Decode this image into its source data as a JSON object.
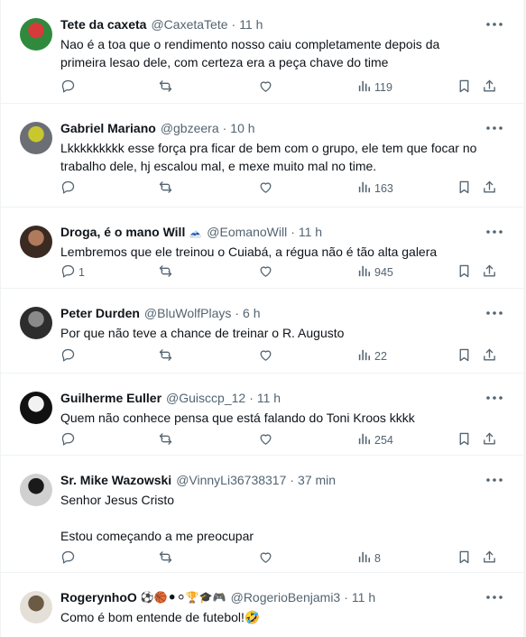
{
  "tweets": [
    {
      "name": "Tete da caxeta",
      "emojis": "",
      "handle": "@CaxetaTete",
      "time": "11 h",
      "lines": [
        "Nao é a toa que o rendimento nosso caiu completamente depois da",
        "primeira lesao dele, com certeza era a peça chave do time"
      ],
      "replies": "",
      "views": "119",
      "avatar_colors": [
        "#d73a3a",
        "#2f8a3e"
      ]
    },
    {
      "name": "Gabriel Mariano",
      "emojis": "",
      "handle": "@gbzeera",
      "time": "10 h",
      "lines": [
        "Lkkkkkkkkk esse força pra ficar de bem com o grupo, ele tem que focar no",
        "trabalho dele, hj escalou mal, e mexe muito mal no time."
      ],
      "replies": "",
      "views": "163",
      "avatar_colors": [
        "#c9c72e",
        "#6b6f75"
      ]
    },
    {
      "name": "Droga, é o mano Will",
      "emojis": "🗻",
      "handle": "@EomanoWill",
      "time": "11 h",
      "lines": [
        "Lembremos que ele treinou o Cuiabá, a régua não é tão alta galera"
      ],
      "replies": "1",
      "views": "945",
      "avatar_colors": [
        "#b07a5c",
        "#3a2a22"
      ]
    },
    {
      "name": "Peter Durden",
      "emojis": "",
      "handle": "@BluWolfPlays",
      "time": "6 h",
      "lines": [
        "Por que não teve a chance de treinar o R. Augusto"
      ],
      "replies": "",
      "views": "22",
      "avatar_colors": [
        "#8a8a8a",
        "#2d2d2d"
      ]
    },
    {
      "name": "Guilherme Euller",
      "emojis": "",
      "handle": "@Guisccp_12",
      "time": "11 h",
      "lines": [
        "Quem não conhece pensa que está falando do Toni Kroos kkkk"
      ],
      "replies": "",
      "views": "254",
      "avatar_colors": [
        "#f2f2f2",
        "#111111"
      ]
    },
    {
      "name": "Sr. Mike Wazowski",
      "emojis": "",
      "handle": "@VinnyLi36738317",
      "time": "37 min",
      "lines": [
        "Senhor Jesus Cristo",
        "",
        "Estou começando a me preocupar"
      ],
      "replies": "",
      "views": "8",
      "avatar_colors": [
        "#1a1a1a",
        "#d0d0d0"
      ]
    },
    {
      "name": "RogerynhoO",
      "emojis": "⚽🏀⚫⚪🏆🎓🎮",
      "handle": "@RogerioBenjami3",
      "time": "11 h",
      "lines": [
        "Como é bom entende de futebol!🤣"
      ],
      "replies": "",
      "views": "",
      "avatar_colors": [
        "#6b5a44",
        "#e4e0d8"
      ]
    }
  ],
  "icons": {
    "more": "more-icon",
    "reply": "reply-icon",
    "retweet": "retweet-icon",
    "like": "like-icon",
    "views": "views-icon",
    "bookmark": "bookmark-icon",
    "share": "share-icon"
  },
  "colors": {
    "text": "#0f1419",
    "muted": "#536471",
    "divider": "#eff3f4"
  }
}
